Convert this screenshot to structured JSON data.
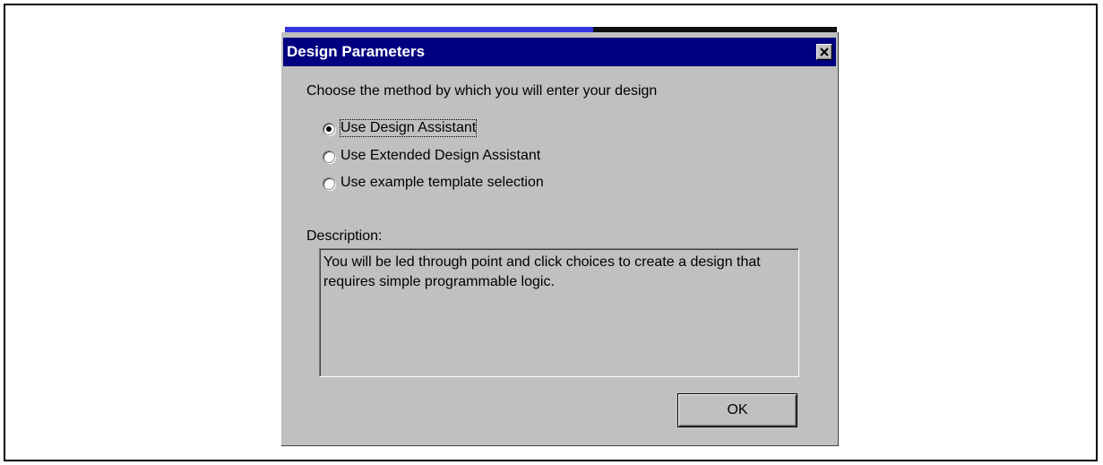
{
  "dialog": {
    "title": "Design Parameters",
    "close_icon": "close-icon",
    "prompt": "Choose the method by which you will enter your design",
    "options": [
      {
        "label": "Use Design Assistant",
        "checked": true
      },
      {
        "label": "Use Extended Design Assistant",
        "checked": false
      },
      {
        "label": "Use example template selection",
        "checked": false
      }
    ],
    "description_label": "Description:",
    "description_text": "You will be led through point and click choices to create a design that requires simple programmable logic.",
    "ok_label": "OK"
  },
  "colors": {
    "title_bar": "#000080",
    "dialog_face": "#c0c0c0",
    "title_text": "#ffffff"
  }
}
